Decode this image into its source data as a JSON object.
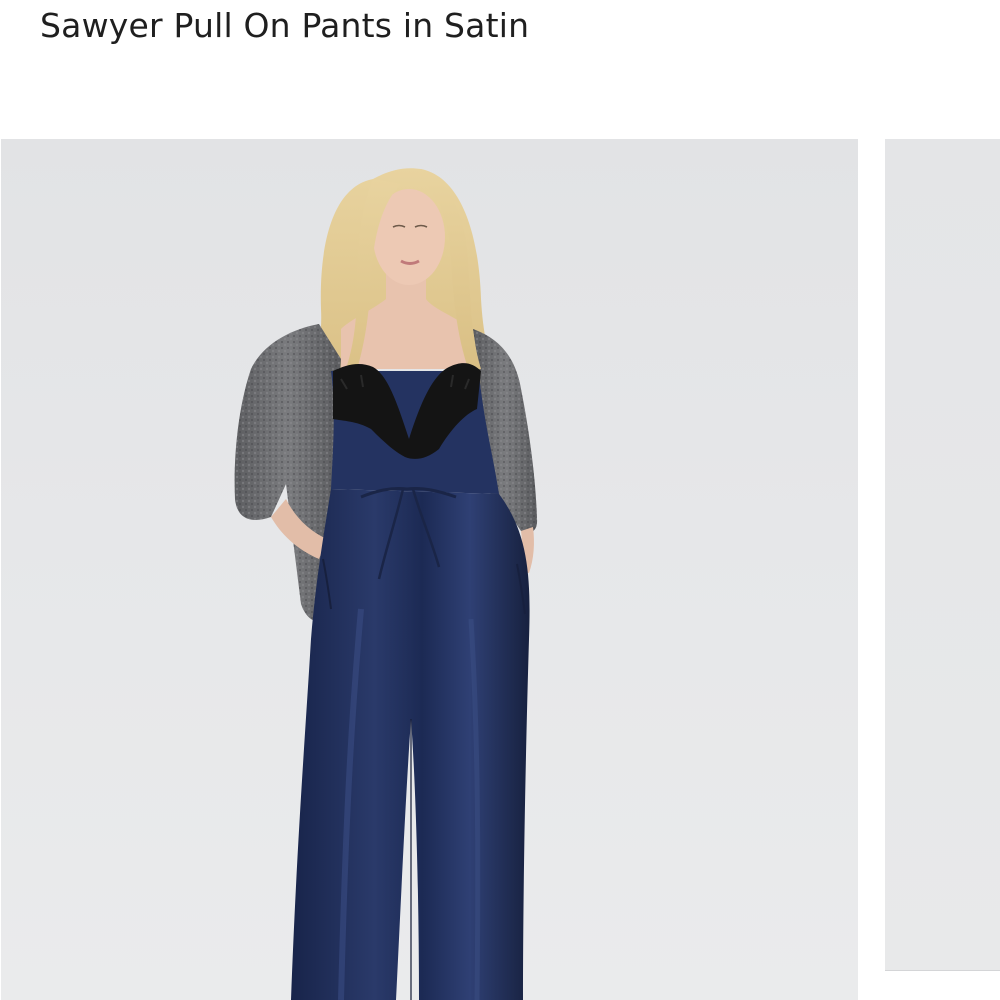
{
  "product": {
    "title": "Sawyer Pull On Pants in Satin"
  },
  "gallery": {
    "images": [
      {
        "alt_name": "model-photo-main"
      },
      {
        "alt_name": "model-photo-next"
      }
    ]
  },
  "colors": {
    "background": "#ffffff",
    "photo_backdrop": "#e5e6e8",
    "pants_navy": "#1f2e56",
    "cardigan_gray": "#6b6c6e",
    "lace_black": "#141414",
    "hair_blonde": "#e6cf9a",
    "skin": "#e9c6b2"
  }
}
